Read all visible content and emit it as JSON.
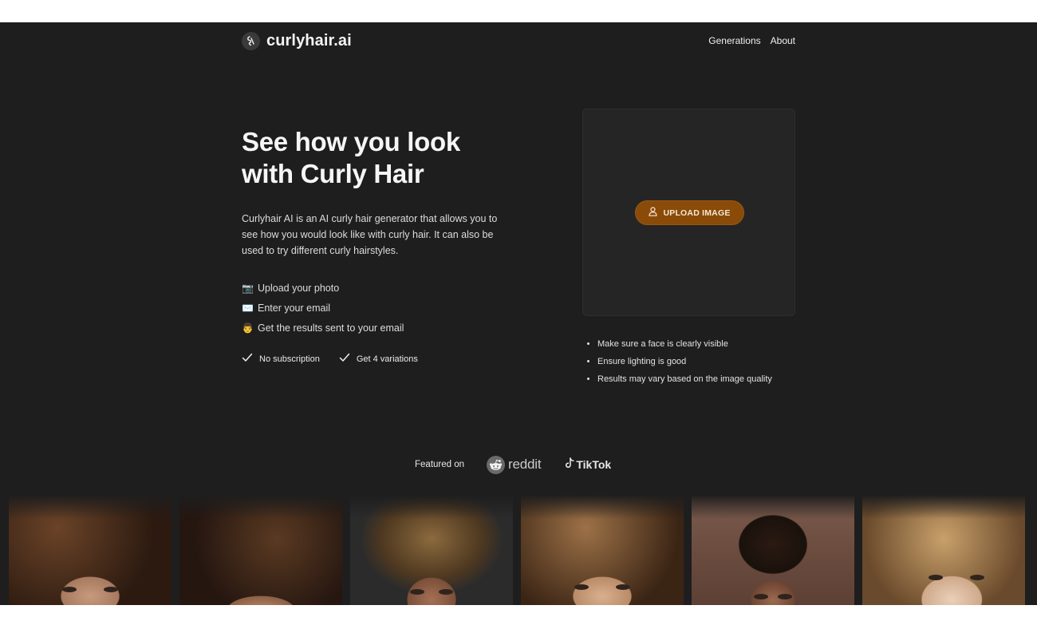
{
  "header": {
    "brand": "curlyhair.ai",
    "nav": [
      "Generations",
      "About"
    ]
  },
  "hero": {
    "title_line1": "See how you look",
    "title_line2": "with Curly Hair",
    "description": "Curlyhair AI is an AI curly hair generator that allows you to see how you would look like with curly hair. It can also be used to try different curly hairstyles.",
    "steps": [
      {
        "emoji": "📷",
        "text": "Upload your photo"
      },
      {
        "emoji": "✉️",
        "text": "Enter your email"
      },
      {
        "emoji": "👨",
        "text": "Get the results sent to your email"
      }
    ],
    "checks": [
      "No subscription",
      "Get 4 variations"
    ]
  },
  "upload": {
    "button_label": "UPLOAD IMAGE",
    "tips": [
      "Make sure a face is clearly visible",
      "Ensure lighting is good",
      "Results may vary based on the image quality"
    ]
  },
  "featured": {
    "label": "Featured on",
    "platforms": [
      "reddit",
      "TikTok"
    ]
  },
  "colors": {
    "background": "#1e1e1e",
    "accent": "#8a4b08",
    "card": "#252525"
  }
}
